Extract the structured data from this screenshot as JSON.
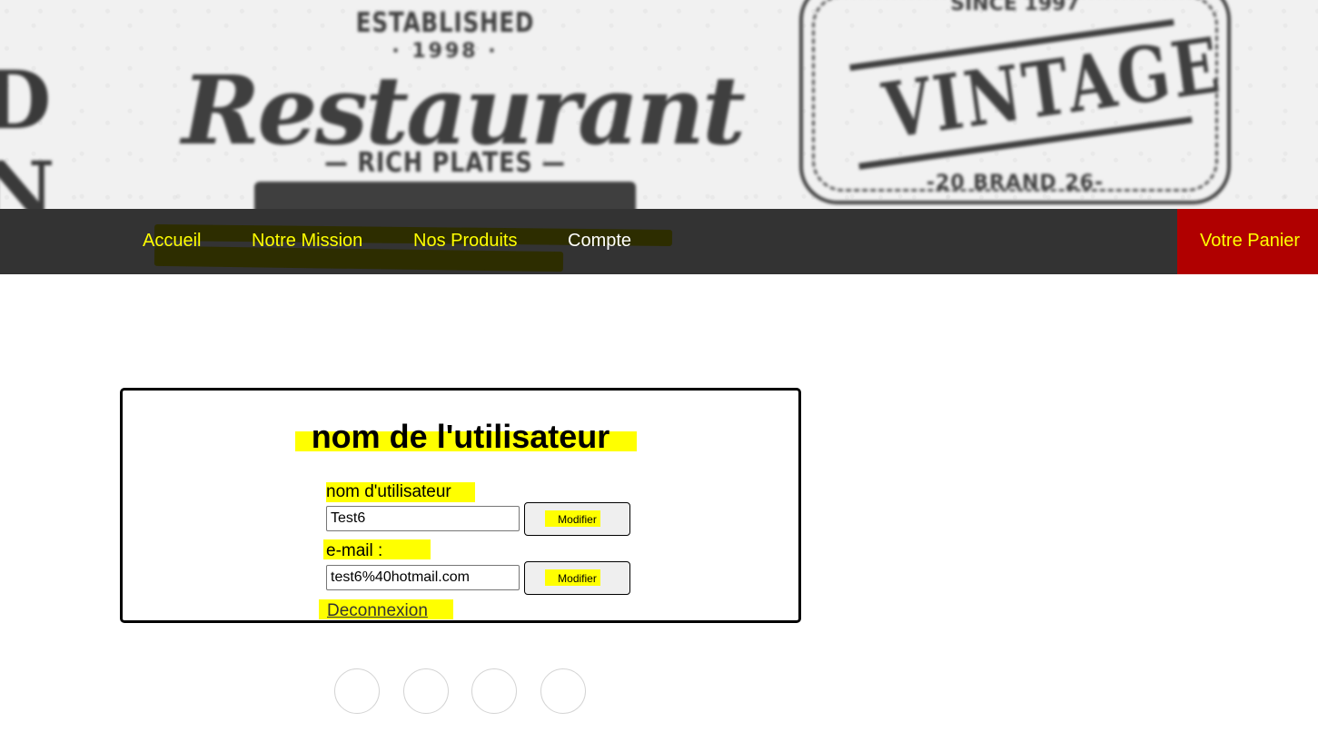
{
  "banner": {
    "left_logo": {
      "text": "D N"
    },
    "restaurant_logo": {
      "established": "ESTABLISHED",
      "year": "· 1998 ·",
      "script": "Restaurant",
      "subline": "— RICH PLATES —"
    },
    "vintage_logo": {
      "since": "SINCE 1997",
      "word": "VINTAGE",
      "brand": "-20 BRAND 26-"
    }
  },
  "nav": {
    "items": [
      {
        "label": "Accueil"
      },
      {
        "label": "Notre Mission"
      },
      {
        "label": "Nos Produits"
      },
      {
        "label": "Compte"
      }
    ],
    "cart_label": "Votre Panier"
  },
  "account": {
    "title": "nom de l'utilisateur",
    "username_label": "nom d'utilisateur",
    "username_value": "Test6",
    "email_label": "e-mail :",
    "email_value": "test6%40hotmail.com",
    "modify_label": "Modifier",
    "logout_label": "Deconnexion"
  },
  "colors": {
    "nav_bg": "#333333",
    "nav_text": "#ffff00",
    "cart_bg": "#b00000",
    "highlight": "#ffff00"
  },
  "social": {
    "icons": [
      "social-icon-1",
      "social-icon-2",
      "social-icon-3",
      "social-icon-4"
    ]
  }
}
